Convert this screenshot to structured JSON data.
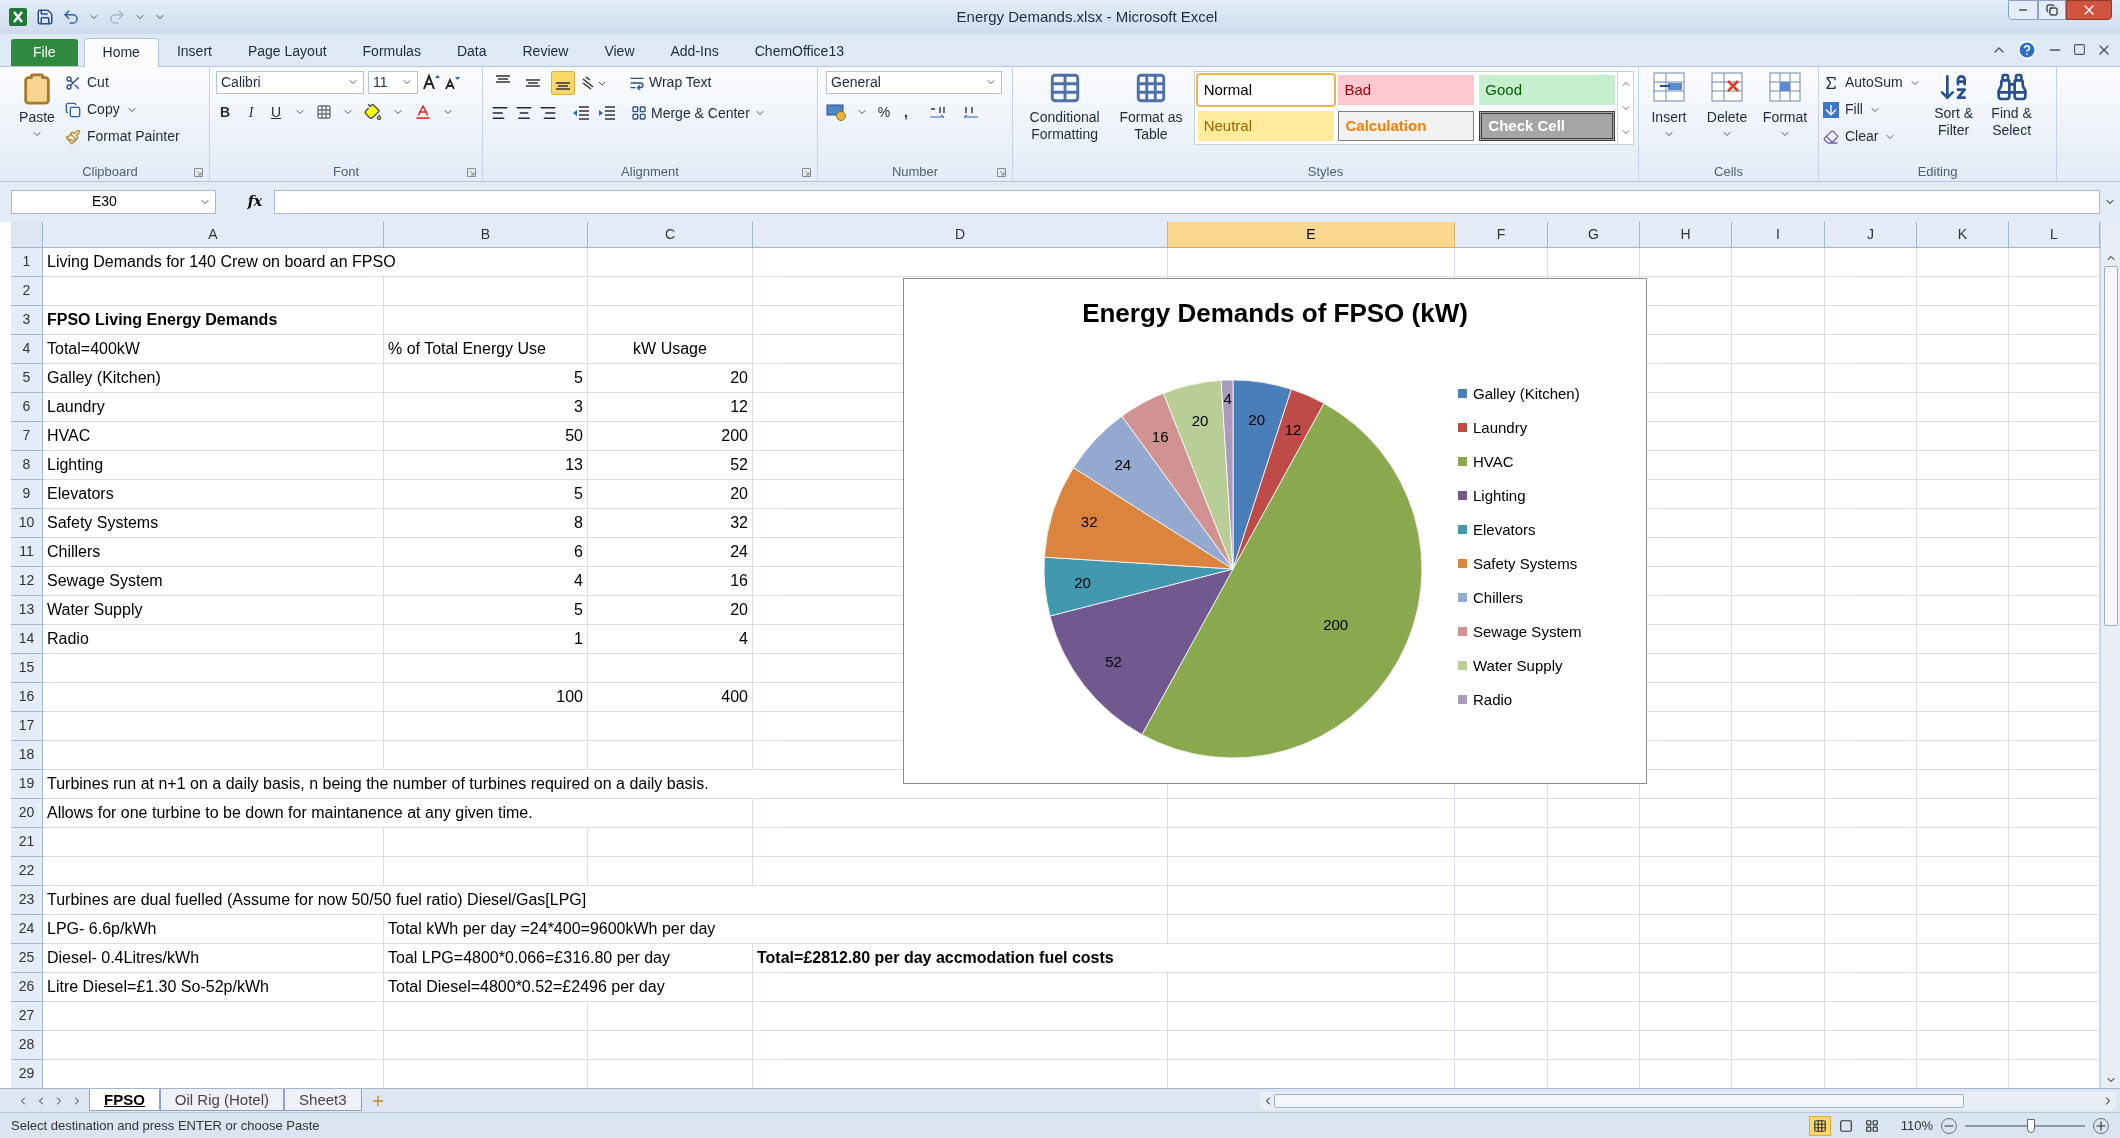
{
  "window": {
    "title": "Energy Demands.xlsx - Microsoft Excel"
  },
  "ribbon_tabs": [
    {
      "label": "File",
      "kind": "file",
      "selected": false
    },
    {
      "label": "Home",
      "kind": "tab",
      "selected": true
    },
    {
      "label": "Insert",
      "kind": "tab",
      "selected": false
    },
    {
      "label": "Page Layout",
      "kind": "tab",
      "selected": false
    },
    {
      "label": "Formulas",
      "kind": "tab",
      "selected": false
    },
    {
      "label": "Data",
      "kind": "tab",
      "selected": false
    },
    {
      "label": "Review",
      "kind": "tab",
      "selected": false
    },
    {
      "label": "View",
      "kind": "tab",
      "selected": false
    },
    {
      "label": "Add-Ins",
      "kind": "tab",
      "selected": false
    },
    {
      "label": "ChemOffice13",
      "kind": "tab",
      "selected": false
    }
  ],
  "clipboard": {
    "label": "Clipboard",
    "paste": "Paste",
    "cut": "Cut",
    "copy": "Copy",
    "format_painter": "Format Painter"
  },
  "font": {
    "label": "Font",
    "family": "Calibri",
    "size": "11",
    "bold": "B",
    "italic": "I",
    "underline": "U"
  },
  "alignment": {
    "label": "Alignment",
    "vertical_buttons": [
      {
        "kind": "top",
        "selected": false
      },
      {
        "kind": "middle",
        "selected": false
      },
      {
        "kind": "bottom",
        "selected": true
      }
    ],
    "wrap_text": "Wrap Text",
    "merge_center": "Merge & Center"
  },
  "number": {
    "label": "Number",
    "format": "General",
    "percent": "%",
    "comma": ","
  },
  "styles": {
    "label": "Styles",
    "conditional_formatting": "Conditional Formatting",
    "format_as_table": "Format as Table",
    "cell_styles": [
      {
        "label": "Normal",
        "kind": "normal",
        "selected": true
      },
      {
        "label": "Bad",
        "kind": "bad",
        "selected": false
      },
      {
        "label": "Good",
        "kind": "good",
        "selected": false
      },
      {
        "label": "Neutral",
        "kind": "neutral",
        "selected": false
      },
      {
        "label": "Calculation",
        "kind": "calculation",
        "selected": false
      },
      {
        "label": "Check Cell",
        "kind": "check",
        "selected": false
      }
    ]
  },
  "cells": {
    "label": "Cells",
    "buttons": [
      {
        "label": "Insert",
        "kind": "insert"
      },
      {
        "label": "Delete",
        "kind": "delete"
      },
      {
        "label": "Format",
        "kind": "format"
      }
    ]
  },
  "editing": {
    "label": "Editing",
    "autosum": "AutoSum",
    "fill": "Fill",
    "clear": "Clear",
    "sort_filter": "Sort & Filter",
    "find_select": "Find & Select"
  },
  "formula_bar": {
    "name_box": "E30",
    "fx": "fx"
  },
  "sheet": {
    "columns": [
      {
        "label": "A",
        "selected": false
      },
      {
        "label": "B",
        "selected": false
      },
      {
        "label": "C",
        "selected": false
      },
      {
        "label": "D",
        "selected": false
      },
      {
        "label": "E",
        "selected": true
      },
      {
        "label": "F",
        "selected": false
      },
      {
        "label": "G",
        "selected": false
      },
      {
        "label": "H",
        "selected": false
      },
      {
        "label": "I",
        "selected": false
      },
      {
        "label": "J",
        "selected": false
      },
      {
        "label": "K",
        "selected": false
      },
      {
        "label": "L",
        "selected": false
      }
    ],
    "rows": [
      {
        "number": "1",
        "cells": {
          "a": {
            "text": "Living Demands for 140 Crew on board an FPSO",
            "kind": "text"
          }
        }
      },
      {
        "number": "2",
        "cells": {}
      },
      {
        "number": "3",
        "cells": {
          "a": {
            "text": "FPSO Living Energy Demands",
            "kind": "text",
            "bold": true
          }
        }
      },
      {
        "number": "4",
        "cells": {
          "a": {
            "text": "Total=400kW",
            "kind": "text"
          },
          "b": {
            "text": "% of Total Energy Use",
            "kind": "text"
          },
          "c": {
            "text": "kW Usage",
            "kind": "centered"
          }
        }
      },
      {
        "number": "5",
        "cells": {
          "a": {
            "text": "Galley (Kitchen)",
            "kind": "text"
          },
          "b": {
            "text": "5",
            "kind": "number"
          },
          "c": {
            "text": "20",
            "kind": "number"
          }
        }
      },
      {
        "number": "6",
        "cells": {
          "a": {
            "text": "Laundry",
            "kind": "text"
          },
          "b": {
            "text": "3",
            "kind": "number"
          },
          "c": {
            "text": "12",
            "kind": "number"
          }
        }
      },
      {
        "number": "7",
        "cells": {
          "a": {
            "text": "HVAC",
            "kind": "text"
          },
          "b": {
            "text": "50",
            "kind": "number"
          },
          "c": {
            "text": "200",
            "kind": "number"
          }
        }
      },
      {
        "number": "8",
        "cells": {
          "a": {
            "text": "Lighting",
            "kind": "text"
          },
          "b": {
            "text": "13",
            "kind": "number"
          },
          "c": {
            "text": "52",
            "kind": "number"
          }
        }
      },
      {
        "number": "9",
        "cells": {
          "a": {
            "text": "Elevators",
            "kind": "text"
          },
          "b": {
            "text": "5",
            "kind": "number"
          },
          "c": {
            "text": "20",
            "kind": "number"
          }
        }
      },
      {
        "number": "10",
        "cells": {
          "a": {
            "text": "Safety Systems",
            "kind": "text"
          },
          "b": {
            "text": "8",
            "kind": "number"
          },
          "c": {
            "text": "32",
            "kind": "number"
          }
        }
      },
      {
        "number": "11",
        "cells": {
          "a": {
            "text": "Chillers",
            "kind": "text"
          },
          "b": {
            "text": "6",
            "kind": "number"
          },
          "c": {
            "text": "24",
            "kind": "number"
          }
        }
      },
      {
        "number": "12",
        "cells": {
          "a": {
            "text": "Sewage System",
            "kind": "text"
          },
          "b": {
            "text": "4",
            "kind": "number"
          },
          "c": {
            "text": "16",
            "kind": "number"
          }
        }
      },
      {
        "number": "13",
        "cells": {
          "a": {
            "text": "Water Supply",
            "kind": "text"
          },
          "b": {
            "text": "5",
            "kind": "number"
          },
          "c": {
            "text": "20",
            "kind": "number"
          }
        }
      },
      {
        "number": "14",
        "cells": {
          "a": {
            "text": "Radio",
            "kind": "text"
          },
          "b": {
            "text": "1",
            "kind": "number"
          },
          "c": {
            "text": "4",
            "kind": "number"
          }
        }
      },
      {
        "number": "15",
        "cells": {}
      },
      {
        "number": "16",
        "cells": {
          "b": {
            "text": "100",
            "kind": "number"
          },
          "c": {
            "text": "400",
            "kind": "number"
          }
        }
      },
      {
        "number": "17",
        "cells": {}
      },
      {
        "number": "18",
        "cells": {}
      },
      {
        "number": "19",
        "cells": {
          "a": {
            "text": "Turbines run at n+1 on a daily basis, n being the number of turbines required on a daily basis.",
            "kind": "text"
          }
        }
      },
      {
        "number": "20",
        "cells": {
          "a": {
            "text": "Allows for one turbine to be down for maintanence at any given time.",
            "kind": "text"
          }
        }
      },
      {
        "number": "21",
        "cells": {}
      },
      {
        "number": "22",
        "cells": {}
      },
      {
        "number": "23",
        "cells": {
          "a": {
            "text": "Turbines are dual fuelled (Assume for now 50/50 fuel ratio) Diesel/Gas[LPG]",
            "kind": "text"
          }
        }
      },
      {
        "number": "24",
        "cells": {
          "a": {
            "text": "LPG- 6.6p/kWh",
            "kind": "text"
          },
          "b": {
            "text": "Total kWh per day =24*400=9600kWh per day",
            "kind": "text"
          }
        }
      },
      {
        "number": "25",
        "cells": {
          "a": {
            "text": "Diesel- 0.4Litres/kWh",
            "kind": "text"
          },
          "b": {
            "text": "Toal LPG=4800*0.066=£316.80 per day",
            "kind": "text"
          },
          "d": {
            "text": "Total=£2812.80 per day accmodation fuel costs",
            "kind": "text",
            "bold": true
          }
        }
      },
      {
        "number": "26",
        "cells": {
          "a": {
            "text": "Litre Diesel=£1.30 So-52p/kWh",
            "kind": "text"
          },
          "b": {
            "text": "Total Diesel=4800*0.52=£2496 per day",
            "kind": "text"
          }
        }
      },
      {
        "number": "27",
        "cells": {}
      },
      {
        "number": "28",
        "cells": {}
      },
      {
        "number": "29",
        "cells": {}
      }
    ],
    "chart_data": {
      "type": "pie",
      "title": "Energy Demands of FPSO (kW)",
      "legend": true,
      "value_labels": [
        "20",
        "12",
        "200",
        "52",
        "20",
        "32",
        "24",
        "16",
        "20",
        "4"
      ],
      "categories": [
        "Galley (Kitchen)",
        "Laundry",
        "HVAC",
        "Lighting",
        "Elevators",
        "Safety Systems",
        "Chillers",
        "Sewage System",
        "Water Supply",
        "Radio"
      ],
      "values": [
        20,
        12,
        200,
        52,
        20,
        32,
        24,
        16,
        20,
        4
      ],
      "colors": [
        "#4a7ebb",
        "#be4b48",
        "#8aa84e",
        "#71588f",
        "#4198af",
        "#db843d",
        "#93a9cf",
        "#d19392",
        "#b9cd96",
        "#a99bbd"
      ]
    }
  },
  "sheet_tabs": [
    {
      "label": "FPSO",
      "selected": true
    },
    {
      "label": "Oil Rig (Hotel)",
      "selected": false
    },
    {
      "label": "Sheet3",
      "selected": false
    }
  ],
  "status_bar": {
    "message": "Select destination and press ENTER or choose Paste",
    "view_buttons": [
      {
        "kind": "normal",
        "selected": true
      },
      {
        "kind": "page_layout",
        "selected": false
      },
      {
        "kind": "page_break",
        "selected": false
      }
    ],
    "zoom": "110%",
    "zoom_level": {
      "level": 0.55
    }
  }
}
